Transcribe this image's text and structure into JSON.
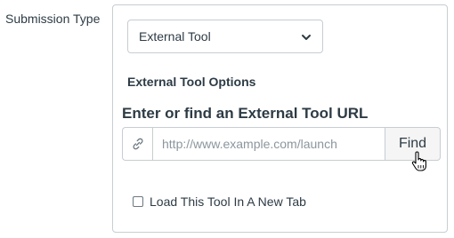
{
  "submission": {
    "label": "Submission Type",
    "selected_type": "External Tool"
  },
  "external_tool": {
    "options_heading": "External Tool Options",
    "url_heading": "Enter or find an External Tool URL",
    "url_placeholder": "http://www.example.com/launch",
    "url_value": "",
    "find_label": "Find",
    "link_icon": "link-icon",
    "new_tab_label": "Load This Tool In A New Tab",
    "new_tab_checked": false
  },
  "cursor": {
    "icon": "hand-pointer-icon"
  }
}
